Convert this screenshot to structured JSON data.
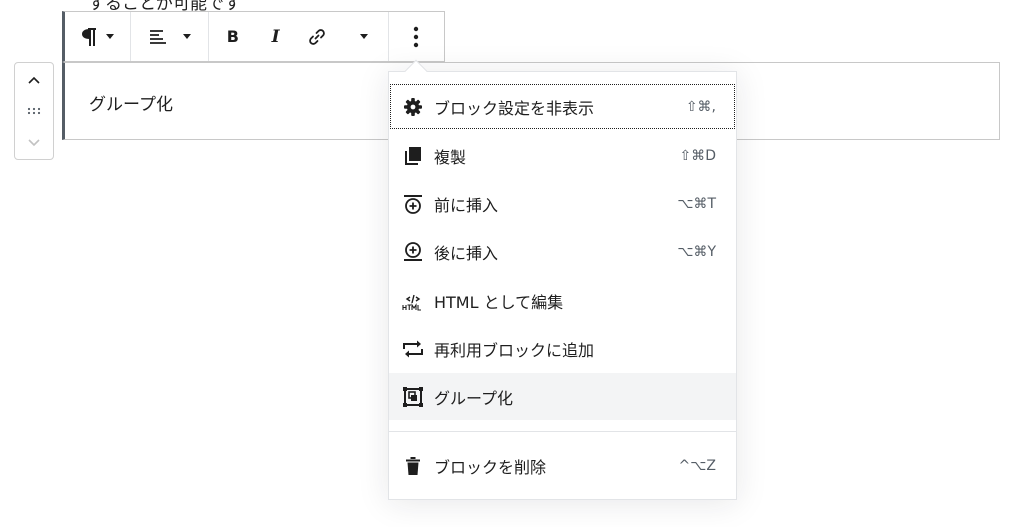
{
  "background_text": "することが可能です",
  "block": {
    "text": "グループ化"
  },
  "toolbar": {
    "paragraph_icon": "pilcrow-icon",
    "align_icon": "align-left-icon",
    "bold_label": "B",
    "italic_label": "I",
    "link_icon": "link-icon",
    "more_icon": "vertical-ellipsis-icon"
  },
  "menu": {
    "items": [
      {
        "icon": "gear-icon",
        "label": "ブロック設定を非表示",
        "shortcut": "⇧⌘,"
      },
      {
        "icon": "duplicate-icon",
        "label": "複製",
        "shortcut": "⇧⌘D"
      },
      {
        "icon": "insert-before-icon",
        "label": "前に挿入",
        "shortcut": "⌥⌘T"
      },
      {
        "icon": "insert-after-icon",
        "label": "後に挿入",
        "shortcut": "⌥⌘Y"
      },
      {
        "icon": "html-icon",
        "label": "HTML として編集",
        "shortcut": ""
      },
      {
        "icon": "reusable-block-icon",
        "label": "再利用ブロックに追加",
        "shortcut": ""
      },
      {
        "icon": "group-icon",
        "label": "グループ化",
        "shortcut": ""
      }
    ],
    "delete": {
      "icon": "trash-icon",
      "label": "ブロックを削除",
      "shortcut": "^⌥Z"
    }
  },
  "colors": {
    "text": "#1e1e1e",
    "border": "#c8c8c8",
    "hover": "#f3f4f5",
    "muted": "#555d66"
  }
}
